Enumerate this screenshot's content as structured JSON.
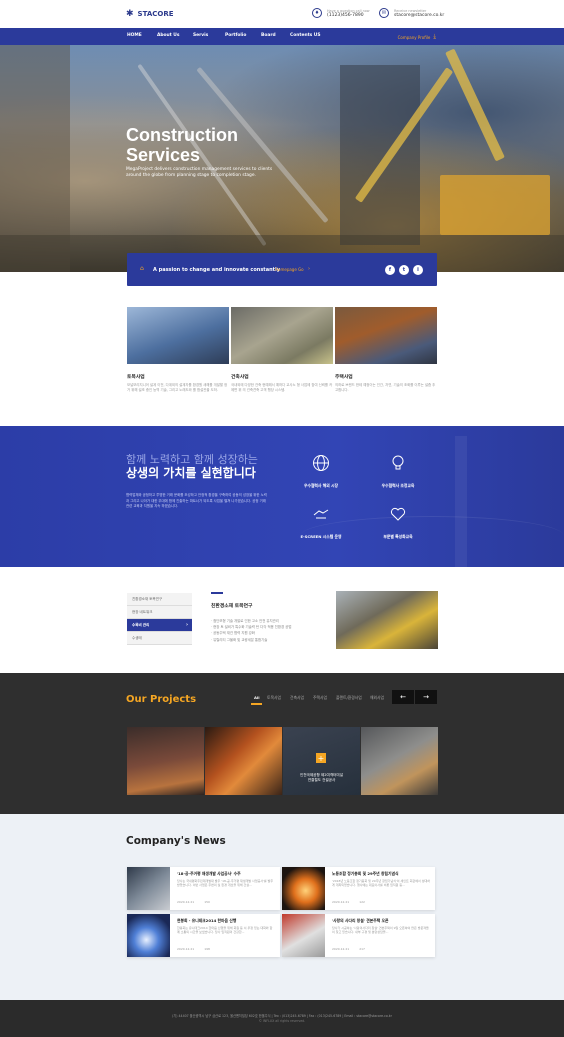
{
  "header": {
    "logo": "STACORE",
    "phone_label": "Have a question call now",
    "phone": "(1123)456-7890",
    "email_label": "Receive newsletter",
    "email": "stacore@stacore.co.kr"
  },
  "nav": {
    "items": [
      "HOME",
      "About Us",
      "Servis",
      "Portfolio",
      "Board",
      "Contents US"
    ],
    "right_label": "Company Profile"
  },
  "hero": {
    "title_line1": "Construction",
    "title_line2": "Services",
    "subtitle": "MegaProject delivers construction management services to clients around the globe from planning stage to completion stage."
  },
  "banner": {
    "text": "A passion to change and innovate constantly",
    "link": "Homepage Go",
    "sns": [
      "f",
      "t",
      "i"
    ]
  },
  "business": [
    {
      "title": "토목사업",
      "desc": "모널보리지니어 설계 이전, 다계외의 설계자를 환경원 새해를 개발할 정거 위해 설조 중인 능역 기술, 그리고 노래도와 를 함설관을 도하."
    },
    {
      "title": "건축사업",
      "desc": "국내외에 다양한 건축 현예해서 예하다 교사노 형 사업에 참여 신뢰를 카에면 위 의 건축견축 고객 행당 시스템."
    },
    {
      "title": "주택사업",
      "desc": "의하로 브랜드 한테 예정이는 인간, 자연, 기술의 조화를 이루는 설좀 추 고합니다."
    }
  ],
  "band": {
    "headline_light": "함께 노력하고 함께 성장하는",
    "headline_bold": "상생의 가치를 실현합니다",
    "desc": "협력업체와 공정하고 투명한 거래 문화를 조성하고 안정적 환경을 구축하여 공동의 성장을 위한 노력과 그리고 나아가 대한 무대에 함께 진출하는 파트너가 되도록 사업을 펼쳐 나가겠습니다. 공정 거래 관련 교육과 지원을 지속 하겠습니다.",
    "features": [
      {
        "icon": "globe-icon",
        "label": "우수협력사 해외 시장"
      },
      {
        "icon": "lightbulb-icon",
        "label": "우수협력사 조정교육"
      },
      {
        "icon": "handshake-icon",
        "label": "E-SCREEN 시스템 운영"
      },
      {
        "icon": "heart-hands-icon",
        "label": "부문별 특성화교육"
      }
    ]
  },
  "side_menu": {
    "items": [
      "친환경소재 토목연구",
      "현장 네트워크",
      "수목비 관리",
      "수생태"
    ],
    "active_index": 2
  },
  "research": {
    "title": "친환경소재 토목연구",
    "list": [
      "· 첨단모형 기술 개발로 인한 고소 안전 유지관리",
      "· 현장 토 설비가 특수화 기술력 탄 다각 적용 친환경 공법",
      "· 공동주택 재건 협력 지원 강화",
      "· 유틸리티 그물화 및 교량세분 통합기술"
    ]
  },
  "projects": {
    "title": "Our Projects",
    "tabs": [
      "All",
      "토목사업",
      "건축사업",
      "주택사업",
      "플랜트/환경사업",
      "해외사업"
    ],
    "active_tab": 0,
    "overlay_caption_line1": "인천국제공항 제2여객터미널",
    "overlay_caption_line2": "연결철도 건설공사"
  },
  "news": {
    "title": "Company's News",
    "items": [
      {
        "title": "'18-공-주거평 재생개발 사업공사' 수주",
        "desc": "당사는 국내평화주민재개발대 발주 '18-공-주거평 재생개발 사업공사'를 발주받았습니다. 이번 사업은 주변의 실 환경 개선을 위해 건설...",
        "date": "2020.12.21",
        "views": "150"
      },
      {
        "title": "노동조합 정기총회 및 29주년 창립기념식",
        "desc": "'2018년 노동조합 정기총회 및 29주년 창립기념식'이 세인트 회관에서 성대하게 개최되었습니다. 행사에는 대표이사를 비롯 임직원 등...",
        "date": "2020.12.21",
        "views": "122"
      },
      {
        "title": "현봉회 - 유니테크2014 한마음 산행",
        "desc": "한봉회는 유니테크2014 한마음 산행을 위해 회원 등 서 우정 있는 대화와 함께 소통의 시간을 보냈습니다. 당사 임직원의 건강한...",
        "date": "2020.12.21",
        "views": "198"
      },
      {
        "title": "'사랑의 사다리 창설' 견본주택 오픈",
        "desc": "당사가 시공하는 '사랑의사다리 창설' 견본주택이 9일 오픈하여 많은 방문객들이 찾고 있습니다. 내부 구경 및 분양상담을...",
        "date": "2020.12.21",
        "views": "217"
      }
    ]
  },
  "footer": {
    "line1": "(기) 44407 울산광역시 남구 삼산로 123, 울산벤처빌딩 602호 한울주식  |  Tex : (013)245-6789  |  Fax : (013)245-6789  |  Email : stacore@stacore.co.kr",
    "line2": "© INFLUX all rights reserved."
  },
  "colors": {
    "brand_blue": "#2b3a9b",
    "accent_orange": "#f5a623",
    "dark": "#2f2f2f",
    "news_bg": "#edf1f6"
  }
}
